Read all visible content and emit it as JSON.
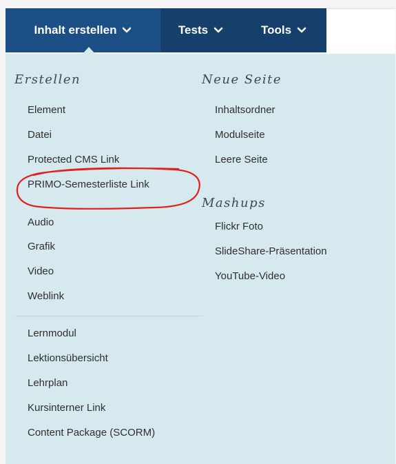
{
  "nav": {
    "tabs": [
      {
        "label": "Inhalt erstellen"
      },
      {
        "label": "Tests"
      },
      {
        "label": "Tools"
      }
    ]
  },
  "menu": {
    "erstellen": {
      "title": "Erstellen",
      "items": [
        "Element",
        "Datei",
        "Protected CMS Link",
        "PRIMO-Semesterliste Link",
        "Audio",
        "Grafik",
        "Video",
        "Weblink"
      ],
      "items2": [
        "Lernmodul",
        "Lektionsübersicht",
        "Lehrplan",
        "Kursinterner Link",
        "Content Package (SCORM)"
      ]
    },
    "neue_seite": {
      "title": "Neue Seite",
      "items": [
        "Inhaltsordner",
        "Modulseite",
        "Leere Seite"
      ]
    },
    "mashups": {
      "title": "Mashups",
      "items": [
        "Flickr Foto",
        "SlideShare-Präsentation",
        "YouTube-Video"
      ]
    }
  },
  "colors": {
    "nav_active": "#1c4f85",
    "nav_inactive": "#163f6c",
    "panel_bg": "#d6e9ee",
    "annotation": "#e0201b"
  },
  "icons": {
    "tab_chevron": "chevron-down-icon"
  }
}
